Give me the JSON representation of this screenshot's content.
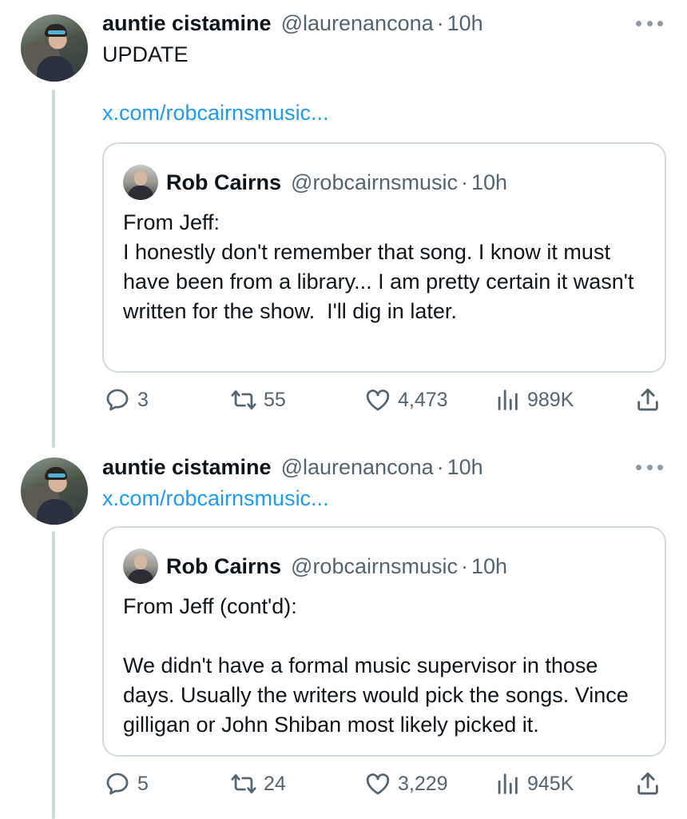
{
  "posts": [
    {
      "author": {
        "name": "auntie cistamine",
        "handle": "@laurenancona",
        "time": "10h"
      },
      "text": "UPDATE",
      "link": "x.com/robcairnsmusic...",
      "quote": {
        "author": {
          "name": "Rob Cairns",
          "handle": "@robcairnsmusic",
          "time": "10h"
        },
        "text": "From Jeff:\nI honestly don't remember that song. I know it must have been from a library... I am pretty certain it wasn't written for the show.  I'll dig in later."
      },
      "stats": {
        "replies": "3",
        "reposts": "55",
        "likes": "4,473",
        "views": "989K"
      }
    },
    {
      "author": {
        "name": "auntie cistamine",
        "handle": "@laurenancona",
        "time": "10h"
      },
      "link": "x.com/robcairnsmusic...",
      "quote": {
        "author": {
          "name": "Rob Cairns",
          "handle": "@robcairnsmusic",
          "time": "10h"
        },
        "text": "From Jeff (cont'd):\n\nWe didn't have a formal music supervisor in those days. Usually the writers would pick the songs. Vince gilligan or John Shiban most likely picked it."
      },
      "stats": {
        "replies": "5",
        "reposts": "24",
        "likes": "3,229",
        "views": "945K"
      }
    }
  ],
  "separator": "·",
  "icons": {
    "reply": "reply-icon",
    "repost": "repost-icon",
    "like": "heart-icon",
    "views": "views-icon",
    "share": "share-icon",
    "more": "more-icon"
  },
  "colors": {
    "link": "#1d9bf0",
    "muted": "#536471",
    "border": "#cfd9de",
    "text": "#0f1419"
  }
}
